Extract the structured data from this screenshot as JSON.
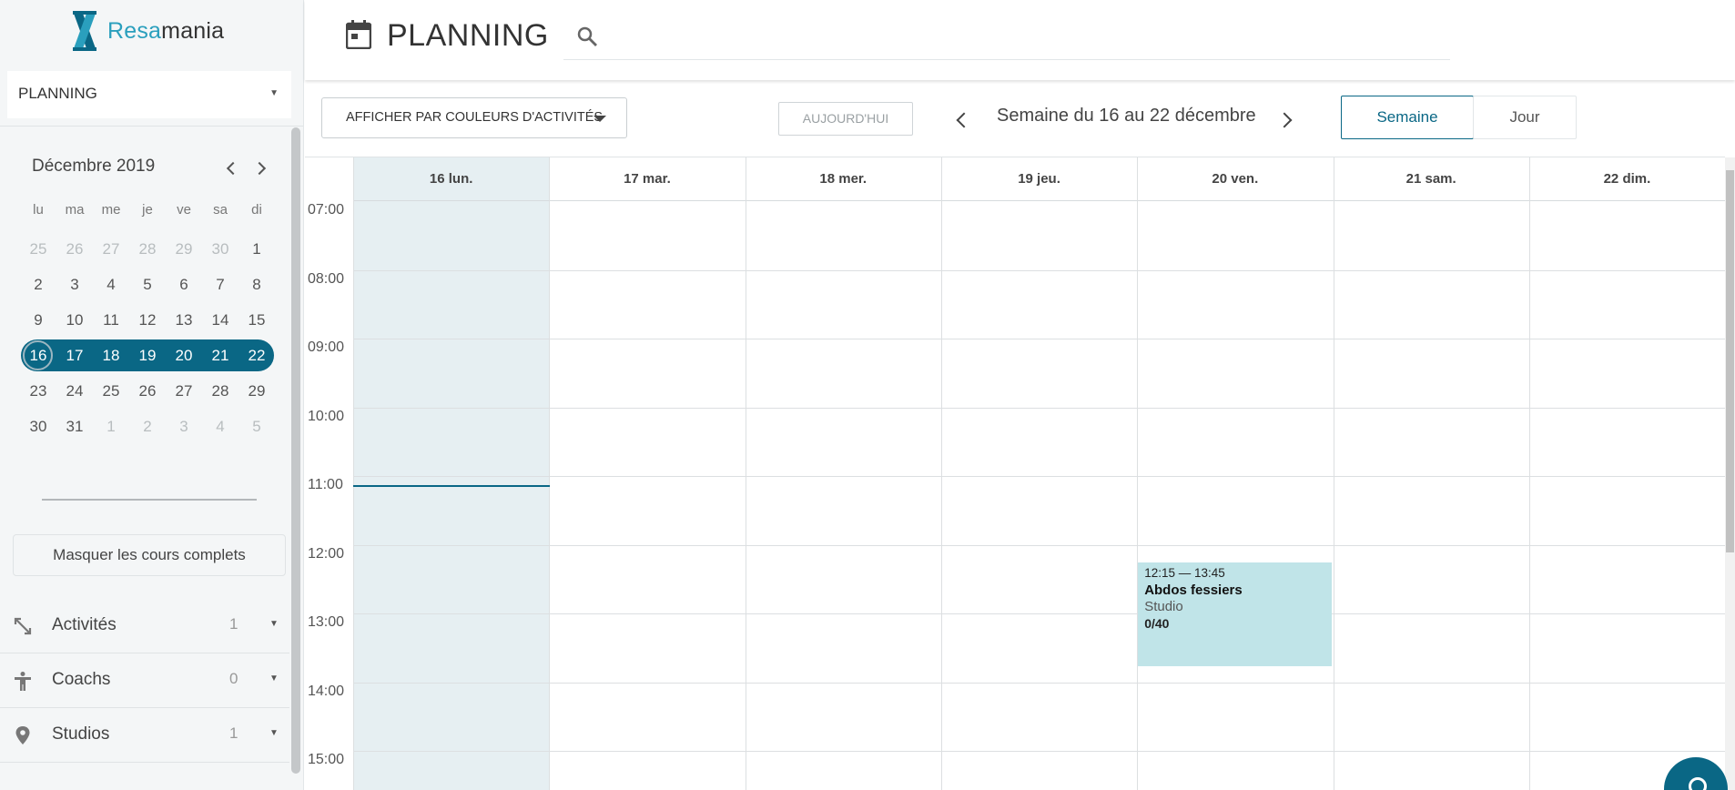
{
  "sidebar": {
    "logo": {
      "text_part1": "Resa",
      "text_part2": "mania"
    },
    "view_select": "PLANNING",
    "mini_calendar": {
      "title": "Décembre 2019",
      "dow": [
        "lu",
        "ma",
        "me",
        "je",
        "ve",
        "sa",
        "di"
      ],
      "weeks": [
        [
          {
            "d": "25",
            "out": true
          },
          {
            "d": "26",
            "out": true
          },
          {
            "d": "27",
            "out": true
          },
          {
            "d": "28",
            "out": true
          },
          {
            "d": "29",
            "out": true
          },
          {
            "d": "30",
            "out": true
          },
          {
            "d": "1"
          }
        ],
        [
          {
            "d": "2"
          },
          {
            "d": "3"
          },
          {
            "d": "4"
          },
          {
            "d": "5"
          },
          {
            "d": "6"
          },
          {
            "d": "7"
          },
          {
            "d": "8"
          }
        ],
        [
          {
            "d": "9"
          },
          {
            "d": "10"
          },
          {
            "d": "11"
          },
          {
            "d": "12"
          },
          {
            "d": "13"
          },
          {
            "d": "14"
          },
          {
            "d": "15"
          }
        ],
        [
          {
            "d": "16",
            "today": true
          },
          {
            "d": "17"
          },
          {
            "d": "18"
          },
          {
            "d": "19"
          },
          {
            "d": "20"
          },
          {
            "d": "21"
          },
          {
            "d": "22"
          }
        ],
        [
          {
            "d": "23"
          },
          {
            "d": "24"
          },
          {
            "d": "25"
          },
          {
            "d": "26"
          },
          {
            "d": "27"
          },
          {
            "d": "28"
          },
          {
            "d": "29"
          }
        ],
        [
          {
            "d": "30"
          },
          {
            "d": "31"
          },
          {
            "d": "1",
            "out": true
          },
          {
            "d": "2",
            "out": true
          },
          {
            "d": "3",
            "out": true
          },
          {
            "d": "4",
            "out": true
          },
          {
            "d": "5",
            "out": true
          }
        ]
      ],
      "selected_week_index": 3
    },
    "hide_full_label": "Masquer les cours complets",
    "filters": [
      {
        "label": "Activités",
        "count": "1",
        "icon": "arrows-icon"
      },
      {
        "label": "Coachs",
        "count": "0",
        "icon": "person-icon"
      },
      {
        "label": "Studios",
        "count": "1",
        "icon": "location-pin-icon"
      }
    ]
  },
  "header": {
    "title": "PLANNING",
    "search_placeholder": ""
  },
  "toolbar": {
    "color_label": "AFFICHER PAR COULEURS D'ACTIVITÉS",
    "today_label": "AUJOURD'HUI",
    "week_label": "Semaine du 16 au 22 décembre",
    "views": {
      "week": "Semaine",
      "day": "Jour"
    }
  },
  "calendar": {
    "days": [
      "16 lun.",
      "17 mar.",
      "18 mer.",
      "19 jeu.",
      "20 ven.",
      "21 sam.",
      "22 dim."
    ],
    "hours": [
      "07:00",
      "08:00",
      "09:00",
      "10:00",
      "11:00",
      "12:00",
      "13:00",
      "14:00",
      "15:00"
    ],
    "event": {
      "time": "12:15 — 13:45",
      "name": "Abdos fessiers",
      "studio": "Studio",
      "capacity": "0/40",
      "day_index": 4,
      "start_hour": 12.25,
      "end_hour": 13.75
    }
  },
  "colors": {
    "primary": "#0a6785",
    "accent": "#2a9fbd",
    "event": "#c0e4e8",
    "today_col": "#e6eff2"
  }
}
